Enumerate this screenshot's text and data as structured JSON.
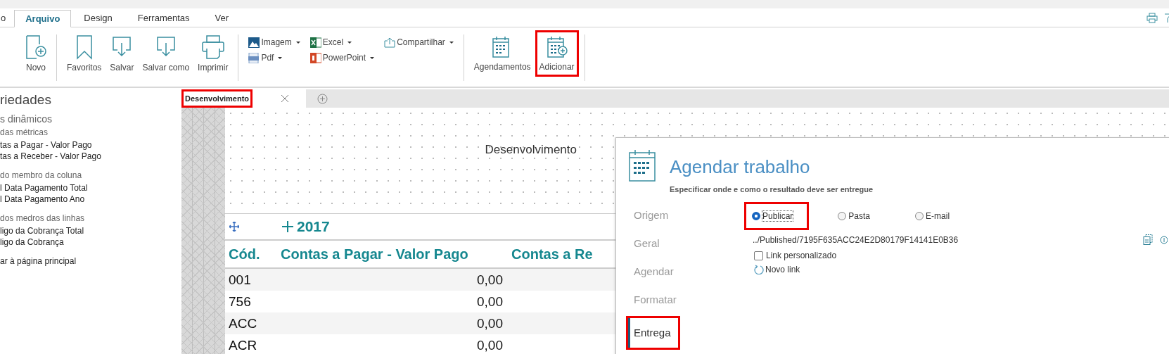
{
  "ribbon_tabs": [
    {
      "label": "o",
      "selected": false
    },
    {
      "label": "Arquivo",
      "selected": true
    },
    {
      "label": "Design",
      "selected": false
    },
    {
      "label": "Ferramentas",
      "selected": false
    },
    {
      "label": "Ver",
      "selected": false
    }
  ],
  "ribbon_groups": [
    {
      "kind": "large",
      "buttons": [
        {
          "label": "Novo",
          "kind": "new",
          "highlighted": false
        }
      ]
    },
    {
      "kind": "large",
      "buttons": [
        {
          "label": "Favoritos",
          "kind": "bookmark",
          "highlighted": false
        },
        {
          "label": "Salvar",
          "kind": "save",
          "highlighted": false
        },
        {
          "label": "Salvar como",
          "kind": "save",
          "highlighted": false
        },
        {
          "label": "Imprimir",
          "kind": "print",
          "highlighted": false
        }
      ]
    },
    {
      "kind": "menus",
      "buttons": [
        {
          "label": "Imagem",
          "kind": "image"
        },
        {
          "label": "Pdf",
          "kind": "pdf"
        },
        {
          "label": "Excel",
          "kind": "excel"
        },
        {
          "label": "PowerPoint",
          "kind": "powerpoint"
        },
        {
          "label": "Compartilhar",
          "kind": "share"
        }
      ]
    },
    {
      "kind": "large",
      "buttons": [
        {
          "label": "Agendamentos",
          "kind": "calendar",
          "highlighted": false
        },
        {
          "label": "Adicionar",
          "kind": "calendar-add",
          "highlighted": true
        }
      ]
    }
  ],
  "properties_panel": {
    "title": "riedades",
    "section": "s dinâmicos",
    "groups": [
      {
        "heading": "das métricas",
        "items": [
          "tas a Pagar - Valor Pago",
          "tas a Receber - Valor Pago"
        ]
      },
      {
        "heading": "do membro da coluna",
        "items": [
          "l Data Pagamento Total",
          "l Data Pagamento Ano"
        ]
      },
      {
        "heading": "dos medros das linhas",
        "items": [
          "ligo da Cobrança Total",
          "ligo da Cobrança"
        ]
      }
    ],
    "link": "ar à página principal"
  },
  "document_tabs": [
    {
      "label": "Desenvolvimento",
      "selected": true,
      "highlighted": true
    }
  ],
  "report": {
    "title": "Desenvolvimento",
    "column_group": "2017",
    "columns": [
      "Cód.",
      "Contas a Pagar - Valor Pago",
      "Contas a Re"
    ],
    "rows": [
      [
        "001",
        "0,00"
      ],
      [
        "756",
        "0,00"
      ],
      [
        "ACC",
        "0,00"
      ],
      [
        "ACR",
        "0,00"
      ]
    ]
  },
  "dialog": {
    "title": "Agendar trabalho",
    "subtitle": "Especificar onde e como o resultado deve ser entregue",
    "nav": [
      {
        "label": "Origem",
        "selected": false,
        "highlighted": false
      },
      {
        "label": "Geral",
        "selected": false,
        "highlighted": false
      },
      {
        "label": "Agendar",
        "selected": false,
        "highlighted": false
      },
      {
        "label": "Formatar",
        "selected": false,
        "highlighted": false
      },
      {
        "label": "Entrega",
        "selected": true,
        "highlighted": true
      }
    ],
    "destinations": [
      {
        "label": "Publicar",
        "selected": true,
        "highlighted": true
      },
      {
        "label": "Pasta",
        "selected": false,
        "highlighted": false
      },
      {
        "label": "E-mail",
        "selected": false,
        "highlighted": false
      }
    ],
    "path": "../Published/7195F635ACC24E2D80179F14141E0B36",
    "custom_link": {
      "label": "Link personalizado",
      "checked": false
    },
    "new_link": "Novo link"
  }
}
